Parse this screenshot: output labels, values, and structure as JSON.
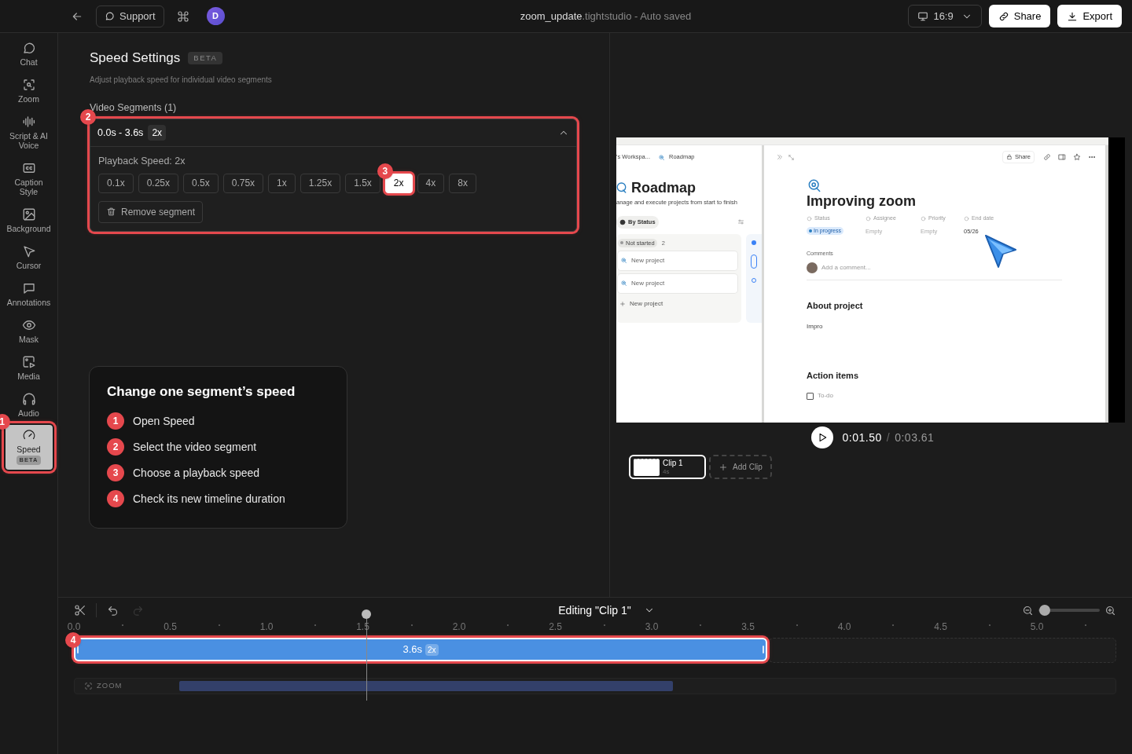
{
  "topbar": {
    "support": "Support",
    "avatar": "D",
    "file_name": "zoom_update",
    "file_ext": ".tightstudio",
    "save_status": "- Auto saved",
    "aspect": "16:9",
    "share": "Share",
    "export": "Export"
  },
  "sidebar": {
    "items": [
      {
        "label": "Chat",
        "selected": false
      },
      {
        "label": "Zoom",
        "selected": false
      },
      {
        "label": "Script & AI Voice",
        "selected": false
      },
      {
        "label": "Caption Style",
        "selected": false
      },
      {
        "label": "Background",
        "selected": false
      },
      {
        "label": "Cursor",
        "selected": false
      },
      {
        "label": "Annotations",
        "selected": false
      },
      {
        "label": "Mask",
        "selected": false
      },
      {
        "label": "Media",
        "selected": false
      },
      {
        "label": "Audio",
        "selected": false
      },
      {
        "label": "Speed",
        "selected": true,
        "badge": "BETA",
        "callout": "1"
      }
    ]
  },
  "speed_panel": {
    "title": "Speed Settings",
    "badge": "BETA",
    "subtitle": "Adjust playback speed for individual video segments",
    "segments_label": "Video Segments (1)",
    "segments": [
      {
        "range": "0.0s - 3.6s",
        "speed": "2x",
        "expanded": true,
        "callout": "2",
        "playback_label": "Playback Speed: 2x",
        "options": [
          {
            "label": "0.1x",
            "selected": false
          },
          {
            "label": "0.25x",
            "selected": false
          },
          {
            "label": "0.5x",
            "selected": false
          },
          {
            "label": "0.75x",
            "selected": false
          },
          {
            "label": "1x",
            "selected": false
          },
          {
            "label": "1.25x",
            "selected": false
          },
          {
            "label": "1.5x",
            "selected": false
          },
          {
            "label": "2x",
            "selected": true,
            "callout": "3"
          },
          {
            "label": "4x",
            "selected": false
          },
          {
            "label": "8x",
            "selected": false
          }
        ],
        "remove": "Remove segment"
      }
    ]
  },
  "guide": {
    "title": "Change one segment’s speed",
    "steps": [
      {
        "number": "1",
        "text": "Open Speed"
      },
      {
        "number": "2",
        "text": "Select the video segment"
      },
      {
        "number": "3",
        "text": "Choose a playback speed"
      },
      {
        "number": "4",
        "text": "Check its new timeline duration"
      }
    ]
  },
  "preview": {
    "frame": {
      "breadcrumb": [
        "'s Workspa...",
        "Roadmap"
      ],
      "share": "Share",
      "db_title": "Roadmap",
      "db_subtitle": "anage and execute projects from start to finish",
      "view": "By Status",
      "group": {
        "label": "Not started",
        "count": "2"
      },
      "cards": [
        "New project",
        "New project"
      ],
      "add_card": "New project",
      "page_title": "Improving zoom",
      "properties": [
        {
          "label": "Status",
          "value": "In progress",
          "kind": "pill"
        },
        {
          "label": "Assignee",
          "value": "Empty",
          "kind": "empty"
        },
        {
          "label": "Priority",
          "value": "Empty",
          "kind": "empty"
        },
        {
          "label": "End date",
          "value": "05/26",
          "kind": "text"
        }
      ],
      "comments_label": "Comments",
      "comment_placeholder": "Add a comment...",
      "sections": [
        {
          "heading": "About project",
          "body": "Impro"
        },
        {
          "heading": "Action items",
          "todo": "To-do"
        }
      ]
    },
    "time": "0:01.50",
    "separator": "/",
    "duration": "0:03.61",
    "clips": [
      {
        "name": "Clip 1",
        "length": "4s",
        "selected": true
      }
    ],
    "add_clip": "Add Clip"
  },
  "timeline": {
    "editing": "Editing \"Clip 1\"",
    "zoom_slider": {
      "level": 0.1
    },
    "ruler": [
      "0.0",
      "0.5",
      "1.0",
      "1.5",
      "2.0",
      "2.5",
      "3.0",
      "3.5",
      "4.0",
      "4.5",
      "5.0"
    ],
    "clip": {
      "duration": "3.6s",
      "speed": "2x",
      "callout": "4"
    },
    "zoom_track": {
      "label": "ZOOM"
    }
  }
}
